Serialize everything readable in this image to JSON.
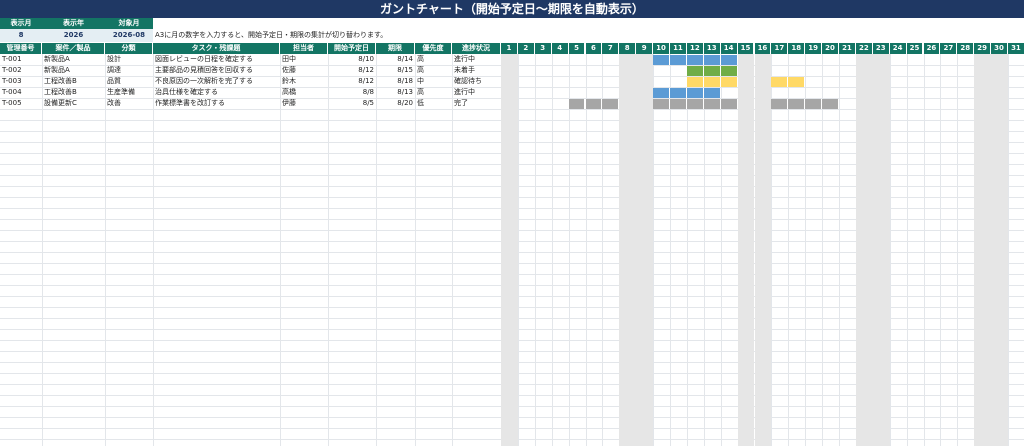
{
  "title": "ガントチャート（開始予定日～期限を自動表示）",
  "settings": {
    "labels": [
      "表示月",
      "表示年",
      "対象月"
    ],
    "values": [
      "8",
      "2026",
      "2026-08"
    ],
    "note": "A3に月の数字を入力すると、開始予定日・期限の集計が切り替わります。"
  },
  "columns": [
    "管理番号",
    "案件／製品",
    "分類",
    "タスク・残課題",
    "担当者",
    "開始予定日",
    "期限",
    "優先度",
    "進捗状況"
  ],
  "days": [
    "1",
    "2",
    "3",
    "4",
    "5",
    "6",
    "7",
    "8",
    "9",
    "10",
    "11",
    "12",
    "13",
    "14",
    "15",
    "16",
    "17",
    "18",
    "19",
    "20",
    "21",
    "22",
    "23",
    "24",
    "25",
    "26",
    "27",
    "28",
    "29",
    "30",
    "31"
  ],
  "weekend_days": [
    1,
    8,
    9,
    15,
    16,
    22,
    23,
    29,
    30
  ],
  "status_colors": {
    "進行中": "#5b9bd5",
    "未着手": "#70ad47",
    "確認待ち": "#ffd966",
    "完了": "#a6a6a6"
  },
  "tasks": [
    {
      "id": "T-001",
      "project": "新製品A",
      "category": "設計",
      "task": "図面レビューの日程を確定する",
      "owner": "田中",
      "start": "8/10",
      "due": "8/14",
      "priority": "高",
      "status": "進行中",
      "bar_days": [
        10,
        11,
        12,
        13,
        14
      ]
    },
    {
      "id": "T-002",
      "project": "新製品A",
      "category": "調達",
      "task": "主要部品の見積回答を回収する",
      "owner": "佐藤",
      "start": "8/12",
      "due": "8/15",
      "priority": "高",
      "status": "未着手",
      "bar_days": [
        12,
        13,
        14
      ]
    },
    {
      "id": "T-003",
      "project": "工程改善B",
      "category": "品質",
      "task": "不良原因の一次解析を完了する",
      "owner": "鈴木",
      "start": "8/12",
      "due": "8/18",
      "priority": "中",
      "status": "確認待ち",
      "bar_days": [
        12,
        13,
        14,
        17,
        18
      ]
    },
    {
      "id": "T-004",
      "project": "工程改善B",
      "category": "生産準備",
      "task": "治具仕様を確定する",
      "owner": "高橋",
      "start": "8/8",
      "due": "8/13",
      "priority": "高",
      "status": "進行中",
      "bar_days": [
        10,
        11,
        12,
        13
      ]
    },
    {
      "id": "T-005",
      "project": "設備更新C",
      "category": "改善",
      "task": "作業標準書を改訂する",
      "owner": "伊藤",
      "start": "8/5",
      "due": "8/20",
      "priority": "低",
      "status": "完了",
      "bar_days": [
        5,
        6,
        7,
        10,
        11,
        12,
        13,
        14,
        17,
        18,
        19,
        20
      ]
    }
  ]
}
